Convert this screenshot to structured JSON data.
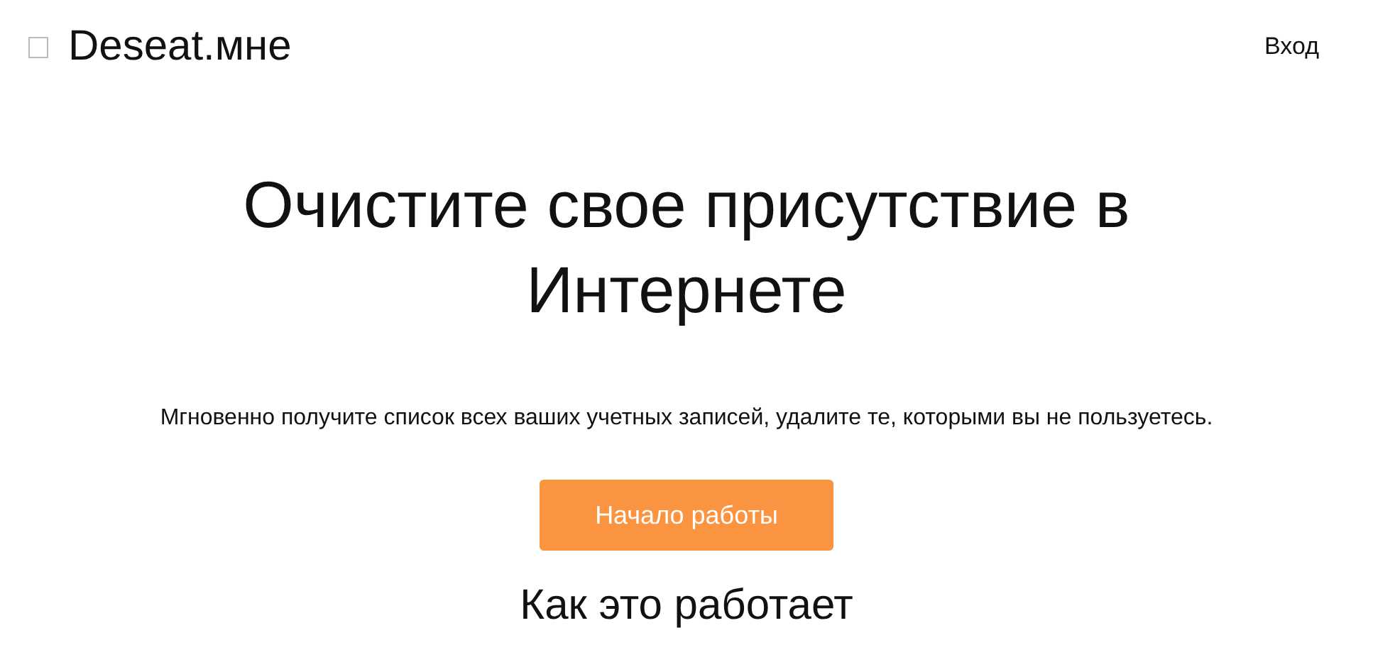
{
  "header": {
    "logo": "Deseat.мне",
    "login": "Вход"
  },
  "hero": {
    "title": "Очистите свое присутствие в Интернете",
    "subtitle": "Мгновенно получите список всех ваших учетных записей, удалите те, которыми вы не пользуетесь.",
    "button": "Начало работы"
  },
  "section": {
    "title": "Как это работает"
  }
}
